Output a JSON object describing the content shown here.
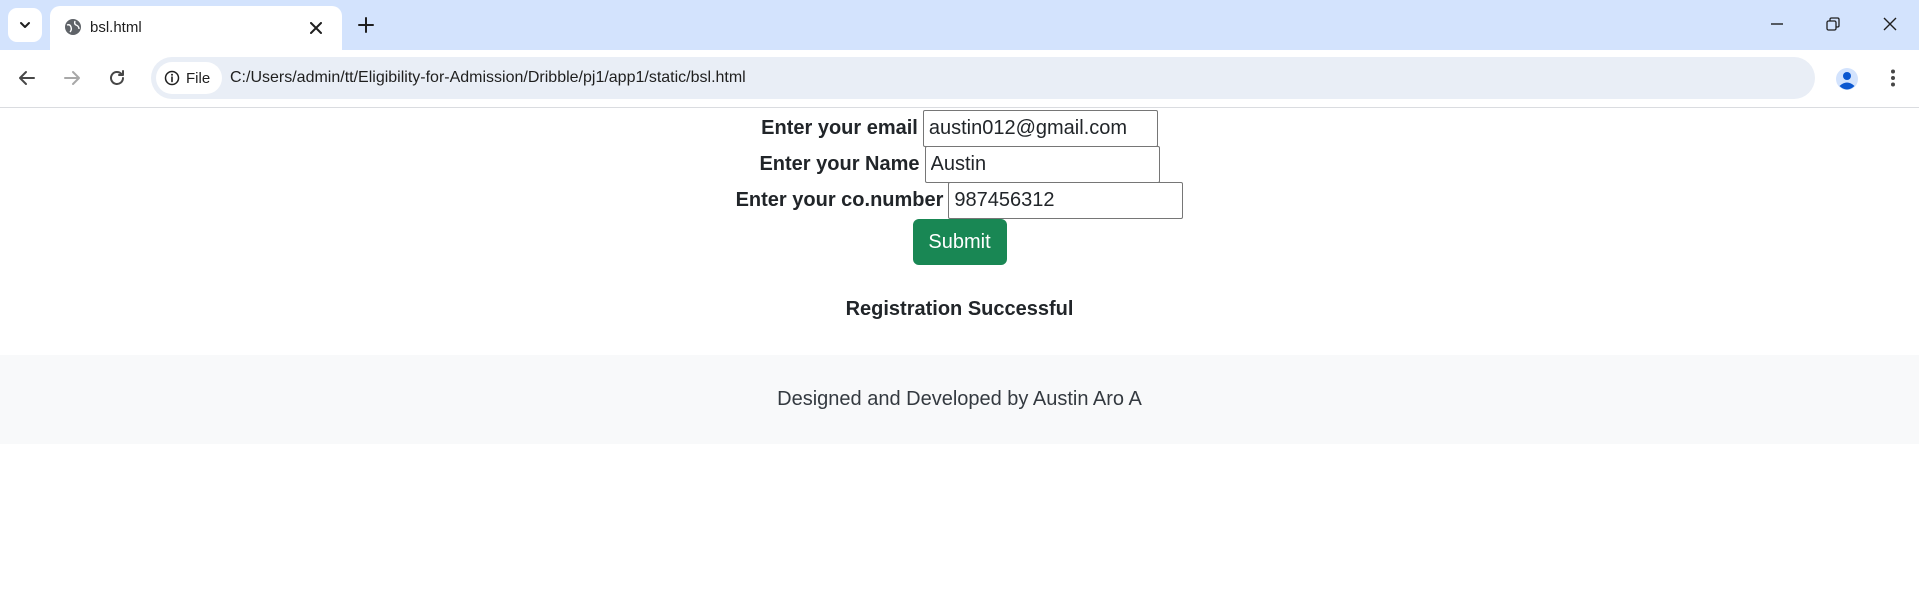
{
  "browser": {
    "tab": {
      "title": "bsl.html"
    },
    "site_chip_label": "File",
    "url": "C:/Users/admin/tt/Eligibility-for-Admission/Dribble/pj1/app1/static/bsl.html"
  },
  "form": {
    "email": {
      "label": "Enter your email",
      "value": "austin012@gmail.com"
    },
    "name": {
      "label": "Enter your Name",
      "value": "Austin"
    },
    "number": {
      "label": "Enter your co.number",
      "value": "987456312"
    },
    "submit_label": "Submit"
  },
  "status_message": "Registration Successful",
  "footer": {
    "text": "Designed and Developed by Austin Aro A"
  },
  "colors": {
    "tabstrip_bg": "#d3e3fd",
    "omnibox_bg": "#e9eef6",
    "submit_bg": "#198754",
    "footer_bg": "#f8f9fa",
    "profile_accent": "#0b57d0"
  }
}
